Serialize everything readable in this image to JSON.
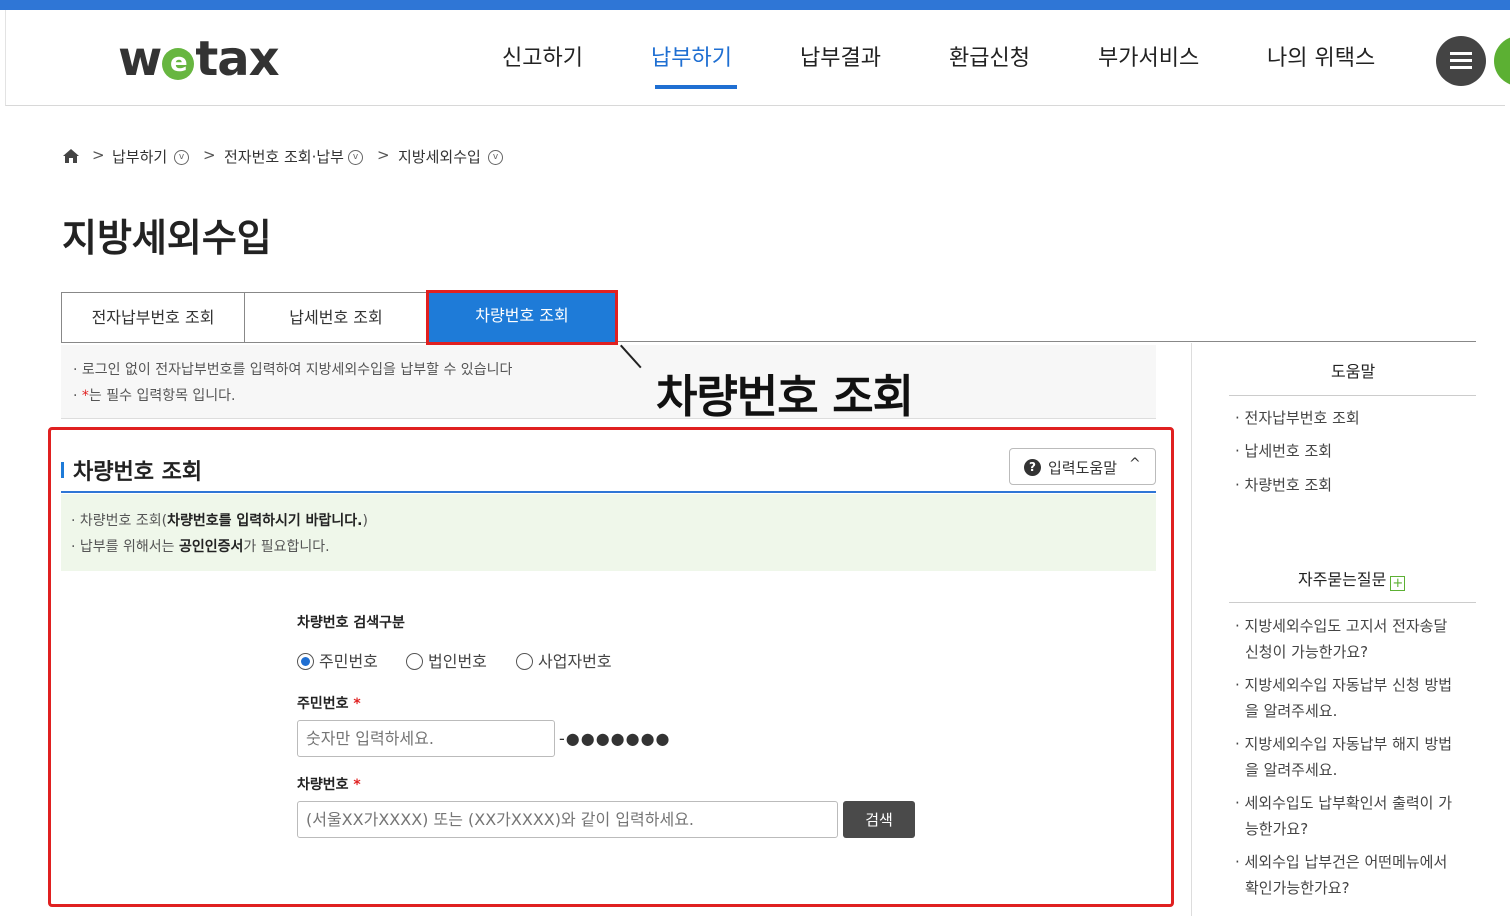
{
  "header": {
    "logo_w": "w",
    "logo_e": "e",
    "logo_rest": "tax",
    "nav": [
      "신고하기",
      "납부하기",
      "납부결과",
      "환급신청",
      "부가서비스",
      "나의 위택스"
    ],
    "active_nav": "납부하기"
  },
  "breadcrumb": {
    "items": [
      "납부하기",
      "전자번호 조회·납부",
      "지방세외수입"
    ],
    "separator": ">"
  },
  "page_title": "지방세외수입",
  "tabs": [
    "전자납부번호 조회",
    "납세번호 조회",
    "차량번호 조회"
  ],
  "active_tab": "차량번호 조회",
  "notice": {
    "line1": "· 로그인 없이 전자납부번호를 입력하여 지방세외수입을 납부할 수 있습니다",
    "line2_prefix": "·   ",
    "line2_star": "*",
    "line2_text": "는 필수 입력항목 입니다."
  },
  "callout": "차량번호 조회",
  "section": {
    "title": "차량번호 조회",
    "help_button": "입력도움말",
    "info1_prefix": "· 차량번호 조회(",
    "info1_bold": "차량번호를 입력하시기 바랍니다.",
    "info1_suffix": ")",
    "info2_prefix": "· 납부를 위해서는 ",
    "info2_bold": "공인인증서",
    "info2_suffix": "가 필요합니다."
  },
  "form": {
    "search_type_label": "차량번호 검색구분",
    "radio_options": [
      "주민번호",
      "법인번호",
      "사업자번호"
    ],
    "selected_radio": "주민번호",
    "resident_label": "주민번호",
    "resident_placeholder": "숫자만 입력하세요.",
    "resident_masked": "-●●●●●●●",
    "car_label": "차량번호",
    "car_placeholder": "(서울XX가XXXX) 또는 (XX가XXXX)와 같이 입력하세요.",
    "search_button": "검색",
    "required_mark": "*"
  },
  "aside": {
    "help_title": "도움말",
    "help_links": [
      "· 전자납부번호 조회",
      "· 납세번호 조회",
      "· 차량번호 조회"
    ],
    "faq_title": "자주묻는질문",
    "faq_plus": "+",
    "faq_links": [
      [
        "· 지방세외수입도 고지서 전자송달",
        "신청이 가능한가요?"
      ],
      [
        "· 지방세외수입 자동납부 신청 방법",
        "을 알려주세요."
      ],
      [
        "· 지방세외수입 자동납부 해지 방법",
        "을 알려주세요."
      ],
      [
        "· 세외수입도 납부확인서 출력이 가",
        "능한가요?"
      ],
      [
        "· 세외수입 납부건은 어떤메뉴에서",
        "확인가능한가요?"
      ]
    ]
  },
  "colors": {
    "brand_blue": "#1f6fd2",
    "highlight_red": "#e02020",
    "logo_green": "#67b640"
  }
}
